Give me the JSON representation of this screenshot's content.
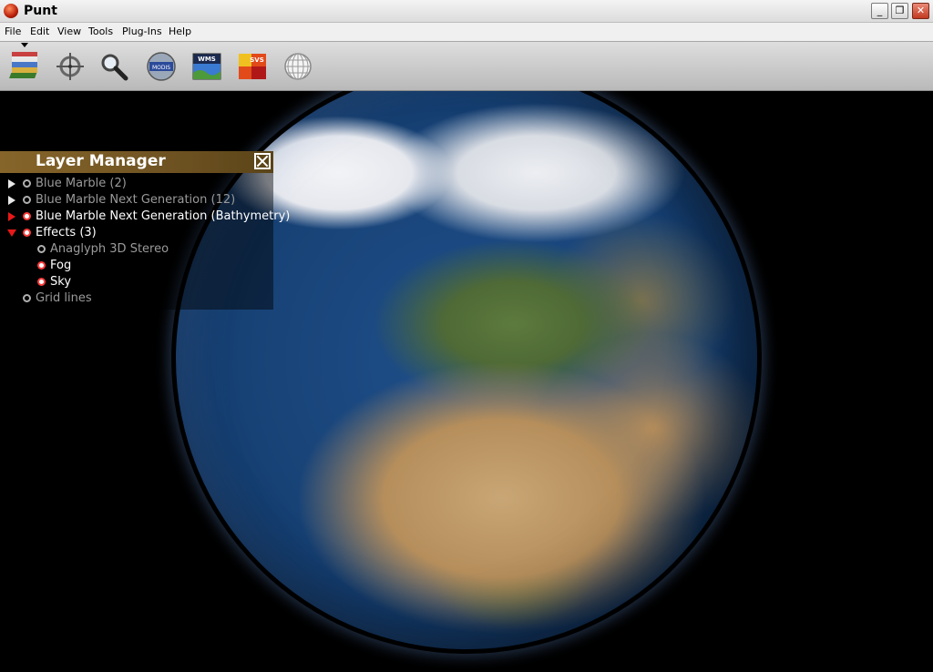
{
  "window": {
    "title": "Punt"
  },
  "menu": [
    {
      "label": "File"
    },
    {
      "label": "Edit"
    },
    {
      "label": "View"
    },
    {
      "label": "Tools"
    },
    {
      "label": "Plug-Ins"
    },
    {
      "label": "Help"
    }
  ],
  "toolbar": {
    "tools": [
      {
        "icon": "layers-icon"
      },
      {
        "icon": "crosshair-icon"
      },
      {
        "icon": "magnifier-icon"
      },
      {
        "icon": "modis-icon",
        "text": "MODIS"
      },
      {
        "icon": "wms-icon",
        "text": "WMS"
      },
      {
        "icon": "svs-icon",
        "text": "SVS"
      },
      {
        "icon": "grid-globe-icon"
      }
    ]
  },
  "layer_manager": {
    "title": "Layer Manager",
    "items": [
      {
        "label": "Blue Marble (2)",
        "enabled": false,
        "expander": "collapsed"
      },
      {
        "label": "Blue Marble Next Generation (12)",
        "enabled": false,
        "expander": "collapsed"
      },
      {
        "label": "Blue Marble Next Generation (Bathymetry)",
        "enabled": true,
        "expander": "collapsed"
      },
      {
        "label": "Effects (3)",
        "enabled": true,
        "expander": "expanded"
      },
      {
        "label": "Anaglyph 3D Stereo",
        "enabled": false,
        "expander": "none"
      },
      {
        "label": "Fog",
        "enabled": true,
        "expander": "none"
      },
      {
        "label": "Sky",
        "enabled": true,
        "expander": "none"
      },
      {
        "label": "Grid lines",
        "enabled": false,
        "expander": "none"
      }
    ]
  },
  "colors": {
    "accent": "#e81818",
    "panel_header": "#86652a",
    "disabled_text": "#9a9a9a"
  }
}
